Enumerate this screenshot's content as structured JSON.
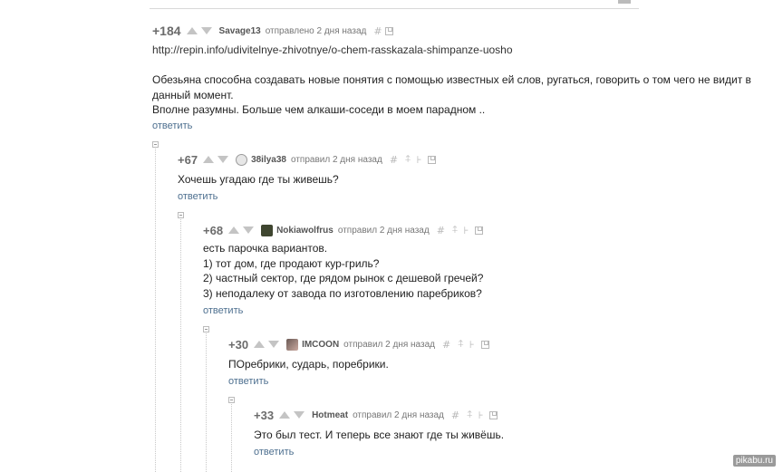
{
  "comments": [
    {
      "rating": "+184",
      "author": "Savage13",
      "meta": "отправлено 2 дня назад",
      "link": "http://repin.info/udivitelnye-zhivotnye/o-chem-rasskazala-shimpanze-uosho",
      "lines": [
        "Обезьяна способна создавать новые понятия с помощью известных ей слов, ругаться, говорить о том чего не видит в",
        "данный момент.",
        "Вполне разумны. Больше чем алкаши-соседи в моем парадном .."
      ],
      "reply": "ответить"
    },
    {
      "rating": "+67",
      "author": "38ilya38",
      "meta": "отправил 2 дня назад",
      "lines": [
        "Хочешь угадаю где ты живешь?"
      ],
      "reply": "ответить"
    },
    {
      "rating": "+68",
      "author": "Nokiawolfrus",
      "meta": "отправил 2 дня назад",
      "lines": [
        "есть парочка вариантов.",
        "1) тот дом, где продают кур-гриль?",
        "2) частный сектор, где рядом рынок с дешевой гречей?",
        "3) неподалеку от завода по изготовлению паребриков?"
      ],
      "reply": "ответить"
    },
    {
      "rating": "+30",
      "author": "IMCOON",
      "meta": "отправил 2 дня назад",
      "lines": [
        "ПОребрики, сударь, поребрики."
      ],
      "reply": "ответить"
    },
    {
      "rating": "+33",
      "author": "Hotmeat",
      "meta": "отправил 2 дня назад",
      "lines": [
        "Это был тест. И теперь все знают где ты живёшь."
      ],
      "reply": "ответить"
    }
  ],
  "icons": {
    "upvote": "arrow-up-icon",
    "downvote": "arrow-down-icon",
    "hash": "#",
    "pin": "pin-icon",
    "tag": "tag-icon",
    "save": "save-icon"
  },
  "watermark": "pikabu.ru"
}
